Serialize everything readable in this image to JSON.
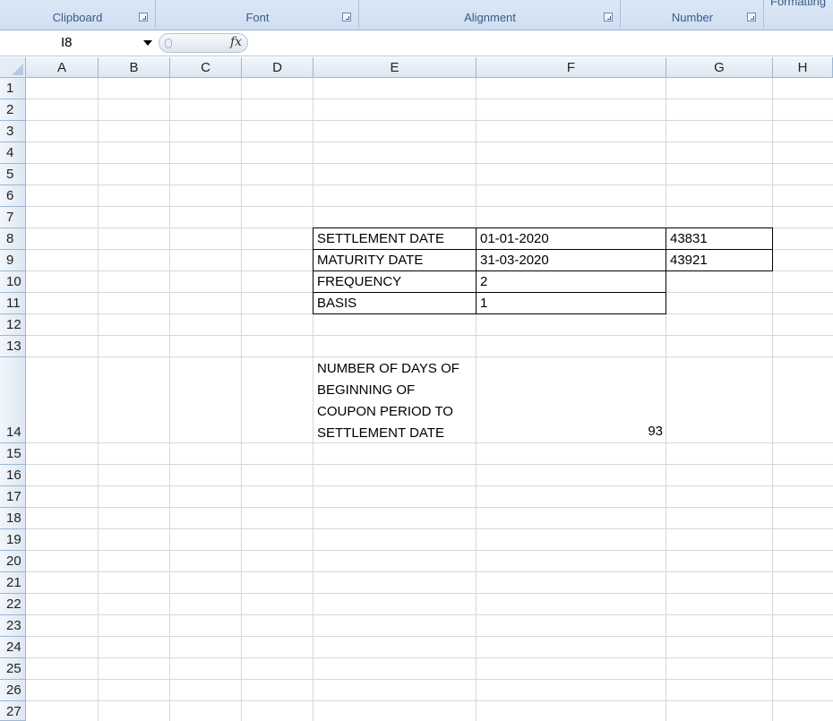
{
  "ribbon": {
    "groups": [
      "Clipboard",
      "Font",
      "Alignment",
      "Number",
      "Formatting"
    ]
  },
  "formula_bar": {
    "name_box": "I8",
    "fx_label": "fx",
    "formula": ""
  },
  "columns": [
    "A",
    "B",
    "C",
    "D",
    "E",
    "F",
    "G",
    "H"
  ],
  "rows": [
    "1",
    "2",
    "3",
    "4",
    "5",
    "6",
    "7",
    "8",
    "9",
    "10",
    "11",
    "12",
    "13",
    "14",
    "15",
    "16",
    "17",
    "18",
    "19",
    "20",
    "21",
    "22",
    "23",
    "24",
    "25",
    "26",
    "27"
  ],
  "cells": {
    "e8": "SETTLEMENT DATE",
    "f8": "01-01-2020",
    "g8": "43831",
    "e9": "MATURITY DATE",
    "f9": "31-03-2020",
    "g9": "43921",
    "e10": "FREQUENCY",
    "f10": "2",
    "e11": "BASIS",
    "f11": "1",
    "e14": "NUMBER OF DAYS OF BEGINNING OF COUPON PERIOD TO SETTLEMENT DATE",
    "f14": "93"
  },
  "colors": {
    "ribbon_label": "#3b5a86",
    "header_bg": "#dde7f3",
    "selected_header": "#f1c15f",
    "gridline": "#d4d8de"
  }
}
